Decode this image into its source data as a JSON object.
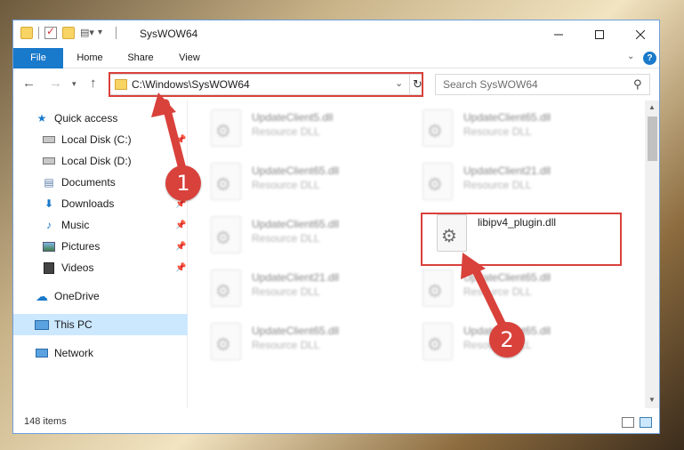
{
  "window": {
    "title": "SysWOW64"
  },
  "ribbon": {
    "tabs": [
      "File",
      "Home",
      "Share",
      "View"
    ],
    "help": "?"
  },
  "navbar": {
    "address": "C:\\Windows\\SysWOW64",
    "search_placeholder": "Search SysWOW64"
  },
  "sidebar": {
    "items": [
      {
        "label": "Quick access",
        "icon": "star-icon"
      },
      {
        "label": "Local Disk (C:)",
        "icon": "drive-icon"
      },
      {
        "label": "Local Disk (D:)",
        "icon": "drive-icon"
      },
      {
        "label": "Documents",
        "icon": "documents-icon"
      },
      {
        "label": "Downloads",
        "icon": "download-icon"
      },
      {
        "label": "Music",
        "icon": "music-icon"
      },
      {
        "label": "Pictures",
        "icon": "pictures-icon"
      },
      {
        "label": "Videos",
        "icon": "videos-icon"
      },
      {
        "label": "OneDrive",
        "icon": "cloud-icon"
      },
      {
        "label": "This PC",
        "icon": "computer-icon"
      },
      {
        "label": "Network",
        "icon": "network-icon"
      }
    ]
  },
  "files": [
    {
      "name": "UpdateClient5.dll",
      "type": "Resource DLL"
    },
    {
      "name": "UpdateClient65.dll",
      "type": "Resource DLL"
    },
    {
      "name": "UpdateClient65.dll",
      "type": "Resource DLL"
    },
    {
      "name": "UpdateClient21.dll",
      "type": "Resource DLL"
    },
    {
      "name": "UpdateClient65.dll",
      "type": "Resource DLL"
    },
    {
      "name": "libipv4_plugin.dll",
      "type": ""
    },
    {
      "name": "UpdateClient21.dll",
      "type": "Resource DLL"
    },
    {
      "name": "UpdateClient65.dll",
      "type": "Resource DLL"
    },
    {
      "name": "UpdateClient65.dll",
      "type": "Resource DLL"
    },
    {
      "name": "UpdateClient65.dll",
      "type": "Resource DLL"
    }
  ],
  "status": {
    "item_count": "148 items"
  },
  "callouts": [
    "1",
    "2"
  ],
  "colors": {
    "accent": "#1979ca",
    "highlight": "#d9413b",
    "selected": "#cce8ff"
  }
}
